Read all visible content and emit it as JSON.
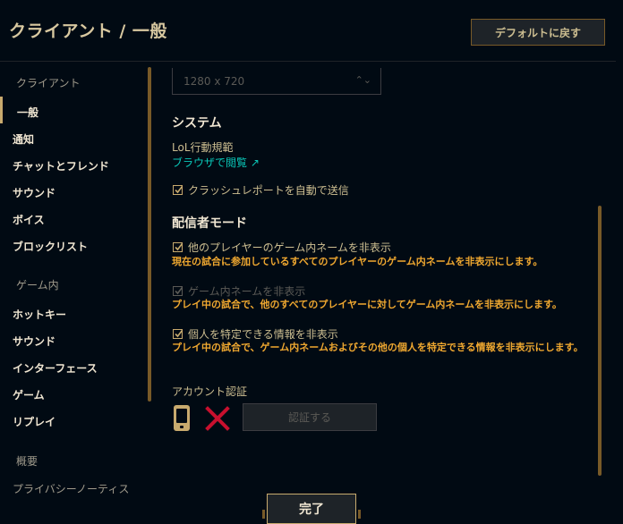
{
  "header": {
    "title": "クライアント / 一般",
    "reset_label": "デフォルトに戻す"
  },
  "sidebar": {
    "section_client": "クライアント",
    "client_items": [
      "一般",
      "通知",
      "チャットとフレンド",
      "サウンド",
      "ボイス",
      "ブロックリスト"
    ],
    "active_item": "一般",
    "section_ingame": "ゲーム内",
    "ingame_items": [
      "ホットキー",
      "サウンド",
      "インターフェース",
      "ゲーム",
      "リプレイ"
    ],
    "section_about": "概要",
    "about_items": [
      "プライバシーノーティス"
    ]
  },
  "main": {
    "resolution_value": "1280 x 720",
    "system": {
      "heading": "システム",
      "tos_label": "LoL行動規範",
      "tos_link": "ブラウザで閲覧 ↗",
      "crash_report_label": "クラッシュレポートを自動で送信",
      "crash_report_checked": true
    },
    "streamer": {
      "heading": "配信者モード",
      "opt1_label": "他のプレイヤーのゲーム内ネームを非表示",
      "opt1_desc": "現在の試合に参加しているすべてのプレイヤーのゲーム内ネームを非表示にします。",
      "opt1_checked": true,
      "opt2_label": "ゲーム内ネームを非表示",
      "opt2_desc": "プレイ中の試合で、他のすべてのプレイヤーに対してゲーム内ネームを非表示にします。",
      "opt2_checked": true,
      "opt2_disabled": true,
      "opt3_label": "個人を特定できる情報を非表示",
      "opt3_desc": "プレイ中の試合で、ゲーム内ネームおよびその他の個人を特定できる情報を非表示にします。",
      "opt3_checked": true
    },
    "account": {
      "label": "アカウント認証",
      "verify_label": "認証する",
      "status_icon": "x-icon",
      "device_icon": "phone-icon"
    }
  },
  "footer": {
    "done_label": "完了"
  },
  "colors": {
    "background": "#010a13",
    "gold": "#c8aa6e",
    "warning": "#f0a830",
    "link": "#0ac8b9",
    "error": "#c8102e"
  }
}
